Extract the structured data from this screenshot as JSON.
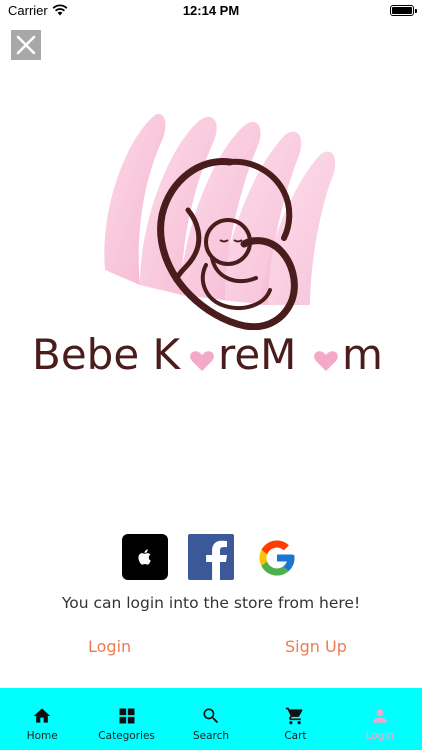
{
  "status_bar": {
    "carrier": "Carrier",
    "time": "12:14 PM"
  },
  "logo": {
    "brand_part1": "Bebe K",
    "brand_part2": "reM",
    "brand_part3": "m",
    "brown": "#4a1c1c",
    "pink": "#f4a9c9"
  },
  "login": {
    "hint": "You can login into the store from here!",
    "login_label": "Login",
    "signup_label": "Sign Up",
    "link_color": "#f07a54"
  },
  "social": {
    "apple_icon": "apple-icon",
    "facebook_icon": "facebook-icon",
    "google_icon": "google-icon"
  },
  "tab_bar": {
    "background": "#00ffff",
    "items": [
      {
        "label": "Home",
        "icon": "home-icon"
      },
      {
        "label": "Categories",
        "icon": "grid-icon"
      },
      {
        "label": "Search",
        "icon": "search-icon"
      },
      {
        "label": "Cart",
        "icon": "cart-icon"
      },
      {
        "label": "Login",
        "icon": "person-icon",
        "active": true
      }
    ]
  }
}
